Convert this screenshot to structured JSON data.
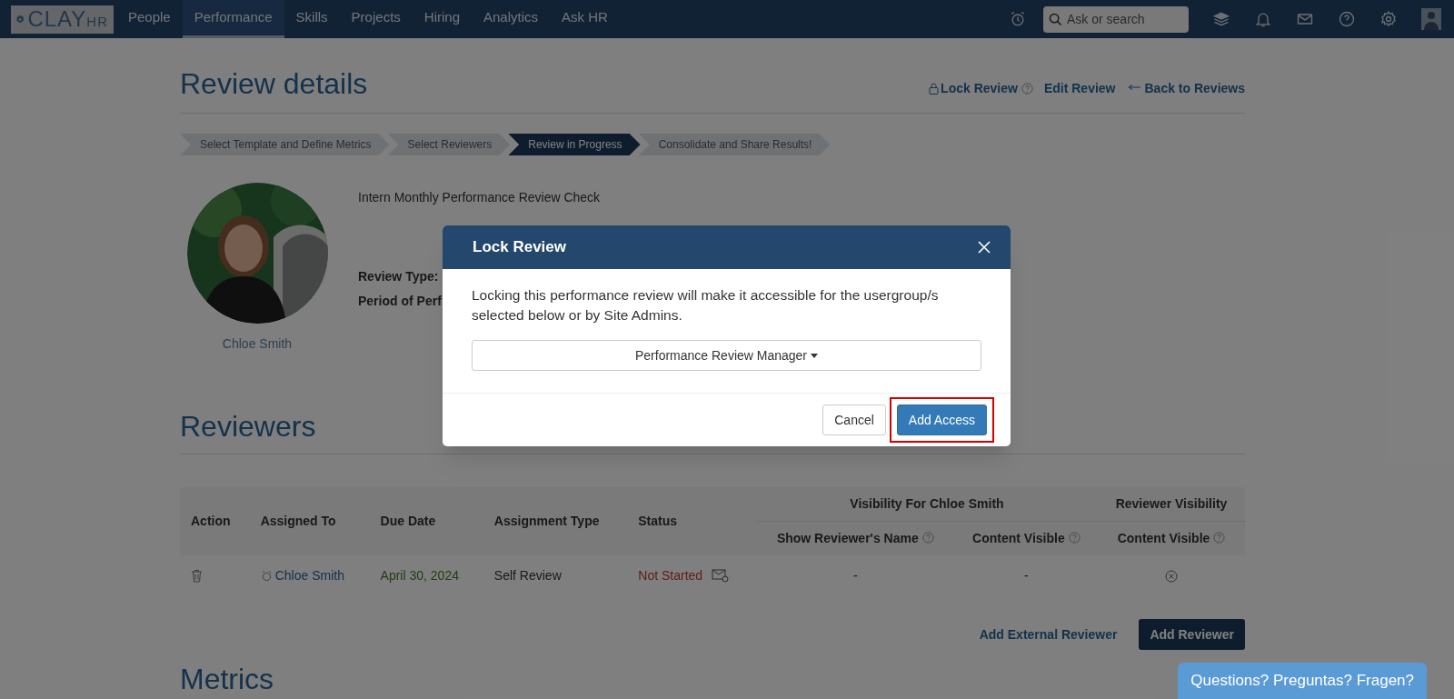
{
  "nav": {
    "logo": {
      "text": "CLAY",
      "suffix": "HR"
    },
    "items": [
      {
        "label": "People",
        "selected": false
      },
      {
        "label": "Performance",
        "selected": true
      },
      {
        "label": "Skills",
        "selected": false
      },
      {
        "label": "Projects",
        "selected": false
      },
      {
        "label": "Hiring",
        "selected": false
      },
      {
        "label": "Analytics",
        "selected": false
      },
      {
        "label": "Ask HR",
        "selected": false
      }
    ],
    "search": {
      "placeholder": "Ask or search"
    }
  },
  "page": {
    "title": "Review details",
    "actions": [
      {
        "label": "Lock Review",
        "kind": "lock"
      },
      {
        "label": "Edit Review",
        "kind": "edit"
      },
      {
        "label": "Back to Reviews",
        "kind": "back"
      }
    ],
    "steps": [
      {
        "label": "Select Template and Define Metrics",
        "selected": false
      },
      {
        "label": "Select Reviewers",
        "selected": false
      },
      {
        "label": "Review in Progress",
        "selected": true
      },
      {
        "label": "Consolidate and Share Results!",
        "selected": false
      }
    ],
    "reviewee": {
      "name": "Chloe Smith"
    },
    "review_title": "Intern Monthly Performance Review Check",
    "fields": [
      "Review Type:",
      "Period of Perf"
    ]
  },
  "reviewers": {
    "title": "Reviewers",
    "group_headers": [
      "Visibility For Chloe Smith",
      "Reviewer Visibility"
    ],
    "columns": [
      "Action",
      "Assigned To",
      "Due Date",
      "Assignment Type",
      "Status"
    ],
    "sub_columns": [
      "Show Reviewer's Name",
      "Content Visible",
      "Content Visible"
    ],
    "rows": [
      {
        "assigned_to": "Chloe Smith",
        "due_date": "April 30, 2024",
        "type": "Self Review",
        "status": "Not Started",
        "show_name": "-",
        "content_visible": "-"
      }
    ],
    "buttons": [
      {
        "label": "Add External Reviewer",
        "kind": "link"
      },
      {
        "label": "Add Reviewer",
        "kind": "primary"
      }
    ]
  },
  "metrics": {
    "title": "Metrics"
  },
  "dialog": {
    "title": "Lock Review",
    "message": "Locking this performance review will make it accessible for the usergroup/s selected below or by Site Admins.",
    "select": "Performance Review Manager",
    "buttons": [
      {
        "label": "Cancel",
        "kind": "default",
        "highlighted": false
      },
      {
        "label": "Add Access",
        "kind": "primary",
        "highlighted": true
      }
    ]
  },
  "help_widget": {
    "label": "Questions? Preguntas? Fragen?"
  }
}
